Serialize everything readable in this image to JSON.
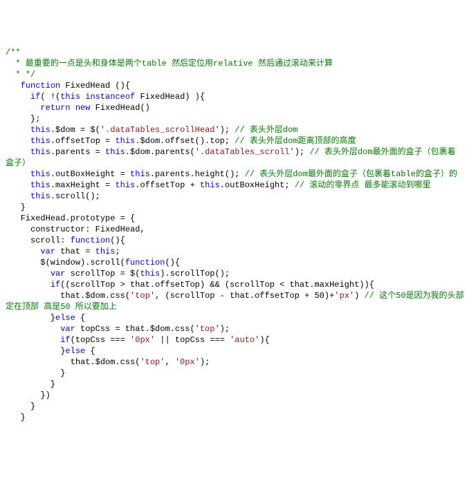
{
  "lines": [
    [
      {
        "t": "/**",
        "c": "c-green"
      }
    ],
    [
      {
        "t": "  * 最重要的一点是头和身体是两个table 然后定位用relative 然后通过滚动来计算",
        "c": "c-green"
      }
    ],
    [
      {
        "t": "  * */",
        "c": "c-green"
      }
    ],
    [
      {
        "t": "   ",
        "c": ""
      },
      {
        "t": "function",
        "c": "c-blue"
      },
      {
        "t": " FixedHead (){",
        "c": ""
      }
    ],
    [
      {
        "t": "     ",
        "c": ""
      },
      {
        "t": "if",
        "c": "c-blue"
      },
      {
        "t": "( !(",
        "c": ""
      },
      {
        "t": "this",
        "c": "c-blue"
      },
      {
        "t": " ",
        "c": ""
      },
      {
        "t": "instanceof",
        "c": "c-blue"
      },
      {
        "t": " FixedHead) ){",
        "c": ""
      }
    ],
    [
      {
        "t": "       ",
        "c": ""
      },
      {
        "t": "return",
        "c": "c-blue"
      },
      {
        "t": " ",
        "c": ""
      },
      {
        "t": "new",
        "c": "c-blue"
      },
      {
        "t": " FixedHead()",
        "c": ""
      }
    ],
    [
      {
        "t": "     };",
        "c": ""
      }
    ],
    [
      {
        "t": "     ",
        "c": ""
      },
      {
        "t": "this",
        "c": "c-blue"
      },
      {
        "t": ".$dom = $(",
        "c": ""
      },
      {
        "t": "'.dataTables_scrollHead'",
        "c": "c-brown"
      },
      {
        "t": "); ",
        "c": ""
      },
      {
        "t": "// 表头外层dom",
        "c": "c-green"
      }
    ],
    [
      {
        "t": "     ",
        "c": ""
      },
      {
        "t": "this",
        "c": "c-blue"
      },
      {
        "t": ".offsetTop = ",
        "c": ""
      },
      {
        "t": "this",
        "c": "c-blue"
      },
      {
        "t": ".$dom.offset().top; ",
        "c": ""
      },
      {
        "t": "// 表头外层dom距离顶部的高度",
        "c": "c-green"
      }
    ],
    [
      {
        "t": "     ",
        "c": ""
      },
      {
        "t": "this",
        "c": "c-blue"
      },
      {
        "t": ".parents = ",
        "c": ""
      },
      {
        "t": "this",
        "c": "c-blue"
      },
      {
        "t": ".$dom.parents(",
        "c": ""
      },
      {
        "t": "'.dataTables_scroll'",
        "c": "c-brown"
      },
      {
        "t": "); ",
        "c": ""
      },
      {
        "t": "// 表头外层dom最外面的盒子（包裹着",
        "c": "c-green"
      }
    ],
    [
      {
        "t": "盒子）",
        "c": "c-green"
      }
    ],
    [
      {
        "t": "     ",
        "c": ""
      },
      {
        "t": "this",
        "c": "c-blue"
      },
      {
        "t": ".outBoxHeight = ",
        "c": ""
      },
      {
        "t": "this",
        "c": "c-blue"
      },
      {
        "t": ".parents.height(); ",
        "c": ""
      },
      {
        "t": "// 表头外层dom最外面的盒子（包裹着table的盒子）的",
        "c": "c-green"
      }
    ],
    [
      {
        "t": "     ",
        "c": ""
      },
      {
        "t": "this",
        "c": "c-blue"
      },
      {
        "t": ".maxHeight = ",
        "c": ""
      },
      {
        "t": "this",
        "c": "c-blue"
      },
      {
        "t": ".offsetTop + ",
        "c": ""
      },
      {
        "t": "this",
        "c": "c-blue"
      },
      {
        "t": ".outBoxHeight; ",
        "c": ""
      },
      {
        "t": "// 滚动的零界点 最多能滚动到哪里",
        "c": "c-green"
      }
    ],
    [
      {
        "t": "     ",
        "c": ""
      },
      {
        "t": "this",
        "c": "c-blue"
      },
      {
        "t": ".scroll();",
        "c": ""
      }
    ],
    [
      {
        "t": "   }",
        "c": ""
      }
    ],
    [
      {
        "t": "   FixedHead.prototype = {",
        "c": ""
      }
    ],
    [
      {
        "t": "     constructor: FixedHead,",
        "c": ""
      }
    ],
    [
      {
        "t": "     scroll: ",
        "c": ""
      },
      {
        "t": "function",
        "c": "c-blue"
      },
      {
        "t": "(){",
        "c": ""
      }
    ],
    [
      {
        "t": "       ",
        "c": ""
      },
      {
        "t": "var",
        "c": "c-blue"
      },
      {
        "t": " that = ",
        "c": ""
      },
      {
        "t": "this",
        "c": "c-blue"
      },
      {
        "t": ";",
        "c": ""
      }
    ],
    [
      {
        "t": "       $(window).scroll(",
        "c": ""
      },
      {
        "t": "function",
        "c": "c-blue"
      },
      {
        "t": "(){",
        "c": ""
      }
    ],
    [
      {
        "t": "         ",
        "c": ""
      },
      {
        "t": "var",
        "c": "c-blue"
      },
      {
        "t": " scrollTop = $(",
        "c": ""
      },
      {
        "t": "this",
        "c": "c-blue"
      },
      {
        "t": ").scrollTop();",
        "c": ""
      }
    ],
    [
      {
        "t": "         ",
        "c": ""
      },
      {
        "t": "if",
        "c": "c-blue"
      },
      {
        "t": "((scrollTop > that.offsetTop) && (scrollTop < that.maxHeight)){",
        "c": ""
      }
    ],
    [
      {
        "t": "           that.$dom.css(",
        "c": ""
      },
      {
        "t": "'top'",
        "c": "c-brown"
      },
      {
        "t": ", (scrollTop - that.offsetTop + 50)+",
        "c": ""
      },
      {
        "t": "'px'",
        "c": "c-brown"
      },
      {
        "t": ") ",
        "c": ""
      },
      {
        "t": "// 这个50是因为我的头部",
        "c": "c-green"
      }
    ],
    [
      {
        "t": "定在顶部 高是50 所以要加上",
        "c": "c-green"
      }
    ],
    [
      {
        "t": "         }",
        "c": ""
      },
      {
        "t": "else",
        "c": "c-blue"
      },
      {
        "t": " {",
        "c": ""
      }
    ],
    [
      {
        "t": "           ",
        "c": ""
      },
      {
        "t": "var",
        "c": "c-blue"
      },
      {
        "t": " topCss = that.$dom.css(",
        "c": ""
      },
      {
        "t": "'top'",
        "c": "c-brown"
      },
      {
        "t": ");",
        "c": ""
      }
    ],
    [
      {
        "t": "           ",
        "c": ""
      },
      {
        "t": "if",
        "c": "c-blue"
      },
      {
        "t": "(topCss === ",
        "c": ""
      },
      {
        "t": "'0px'",
        "c": "c-brown"
      },
      {
        "t": " || topCss === ",
        "c": ""
      },
      {
        "t": "'auto'",
        "c": "c-brown"
      },
      {
        "t": "){",
        "c": ""
      }
    ],
    [
      {
        "t": "           }",
        "c": ""
      },
      {
        "t": "else",
        "c": "c-blue"
      },
      {
        "t": " {",
        "c": ""
      }
    ],
    [
      {
        "t": "             that.$dom.css(",
        "c": ""
      },
      {
        "t": "'top'",
        "c": "c-brown"
      },
      {
        "t": ", ",
        "c": ""
      },
      {
        "t": "'0px'",
        "c": "c-brown"
      },
      {
        "t": ");",
        "c": ""
      }
    ],
    [
      {
        "t": "           }",
        "c": ""
      }
    ],
    [
      {
        "t": "         }",
        "c": ""
      }
    ],
    [
      {
        "t": "       })",
        "c": ""
      }
    ],
    [
      {
        "t": "     }",
        "c": ""
      }
    ],
    [
      {
        "t": "   }",
        "c": ""
      }
    ]
  ]
}
